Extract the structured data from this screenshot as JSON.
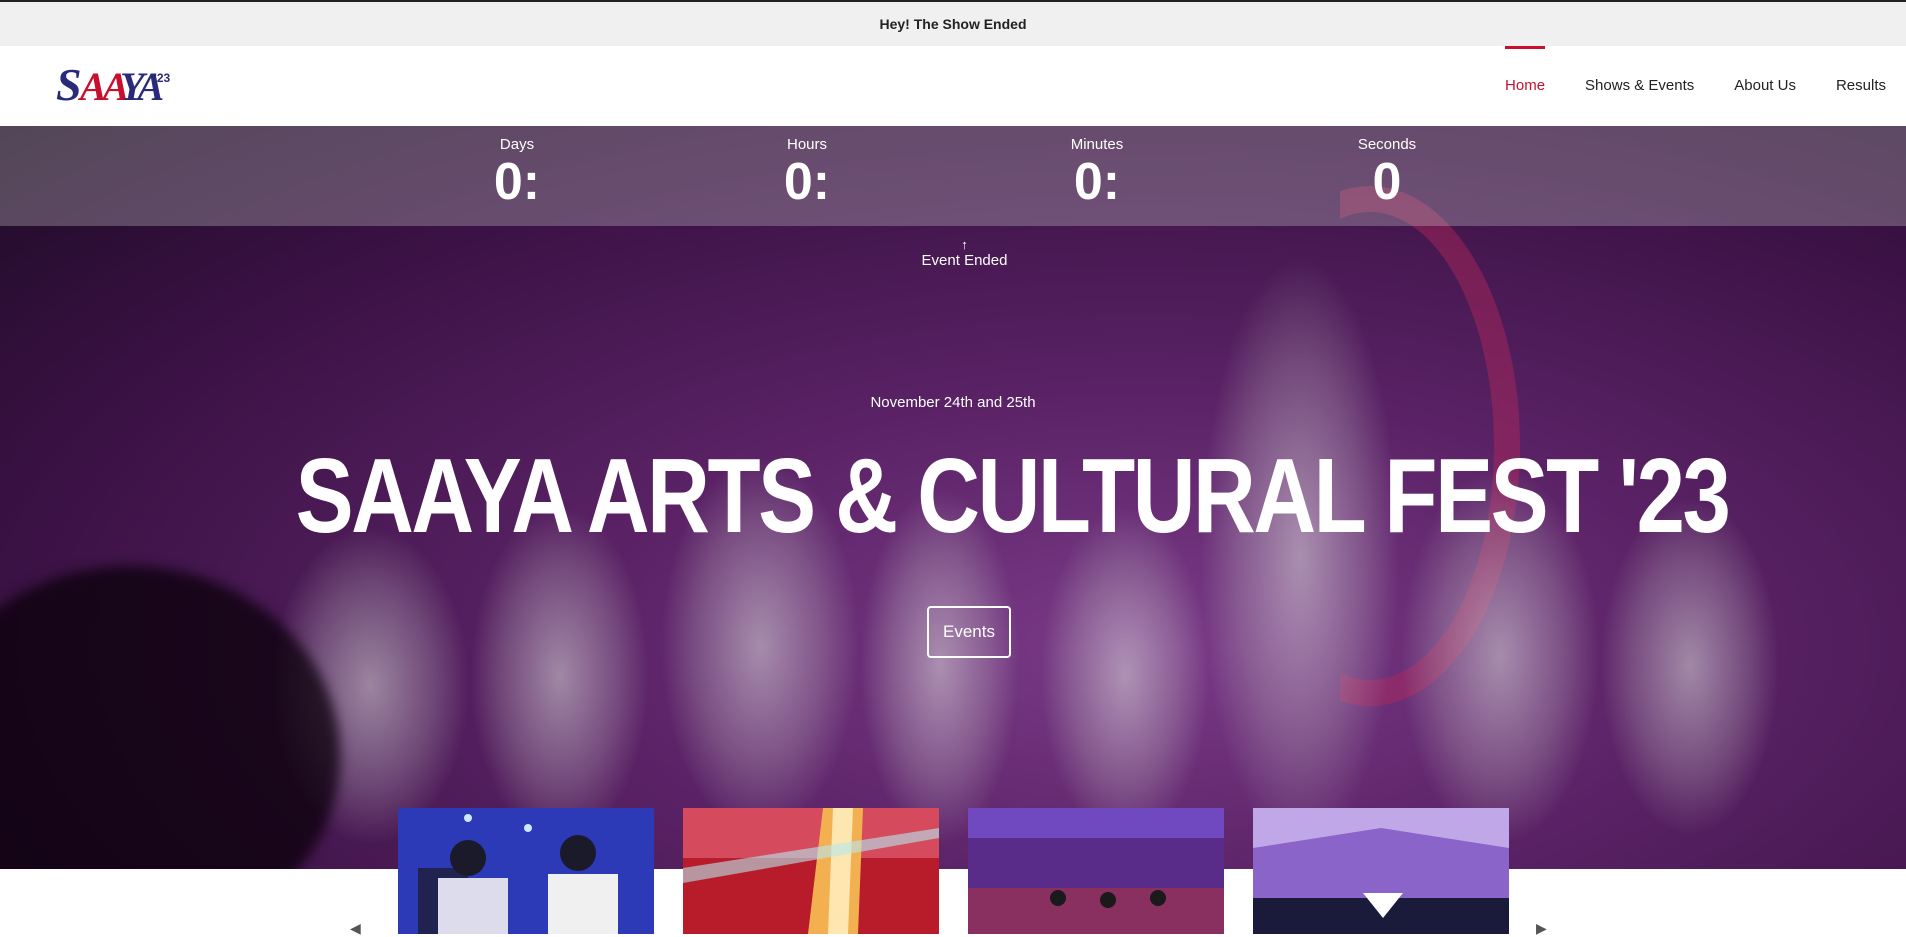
{
  "announcement": "Hey! The Show Ended",
  "logo": {
    "text": "SAAYA",
    "sup": "'23"
  },
  "nav": {
    "items": [
      {
        "label": "Home",
        "active": true
      },
      {
        "label": "Shows & Events",
        "active": false
      },
      {
        "label": "About Us",
        "active": false
      },
      {
        "label": "Results",
        "active": false
      }
    ]
  },
  "countdown": {
    "days": {
      "label": "Days",
      "value": "0:"
    },
    "hours": {
      "label": "Hours",
      "value": "0:"
    },
    "minutes": {
      "label": "Minutes",
      "value": "0:"
    },
    "seconds": {
      "label": "Seconds",
      "value": "0"
    }
  },
  "status": "Event Ended",
  "hero": {
    "date": "November 24th and 25th",
    "title": "SAAYA ARTS & CULTURAL FEST '23",
    "button": "Events"
  },
  "colors": {
    "accent": "#c8102e",
    "hero_base": "#4a1a57"
  },
  "icons": {
    "status": "arrow-up-icon",
    "prev": "chevron-left-icon",
    "next": "chevron-right-icon"
  }
}
